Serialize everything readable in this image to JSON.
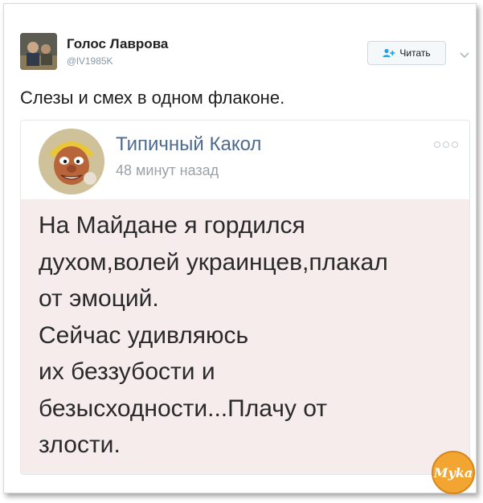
{
  "author": {
    "name": "Голос Лаврова",
    "handle": "@lV1985K",
    "avatar_icon": "user-photo-avatar"
  },
  "follow_button": {
    "label": "Читать",
    "icon": "add-user-icon",
    "color": "#1da1f2"
  },
  "menu_caret_icon": "chevron-down-icon",
  "tweet_text": "Слезы и смех в одном флаконе.",
  "embedded_post": {
    "author": "Типичный Какол",
    "time": "48 минут назад",
    "avatar_icon": "cartoon-face-avatar",
    "more_icon": "more-dots-icon",
    "lines": [
      "На Майдане я гордился",
      "духом,волей украинцев,плакал",
      "от эмоций.",
      "Сейчас удивляюсь",
      "их беззубости и",
      "безысходности...Плачу от",
      "злости."
    ],
    "name_color": "#4d6a8f",
    "background_color": "#f6ecec"
  },
  "watermark": {
    "text": "Myka",
    "icon": "watermark-logo"
  }
}
